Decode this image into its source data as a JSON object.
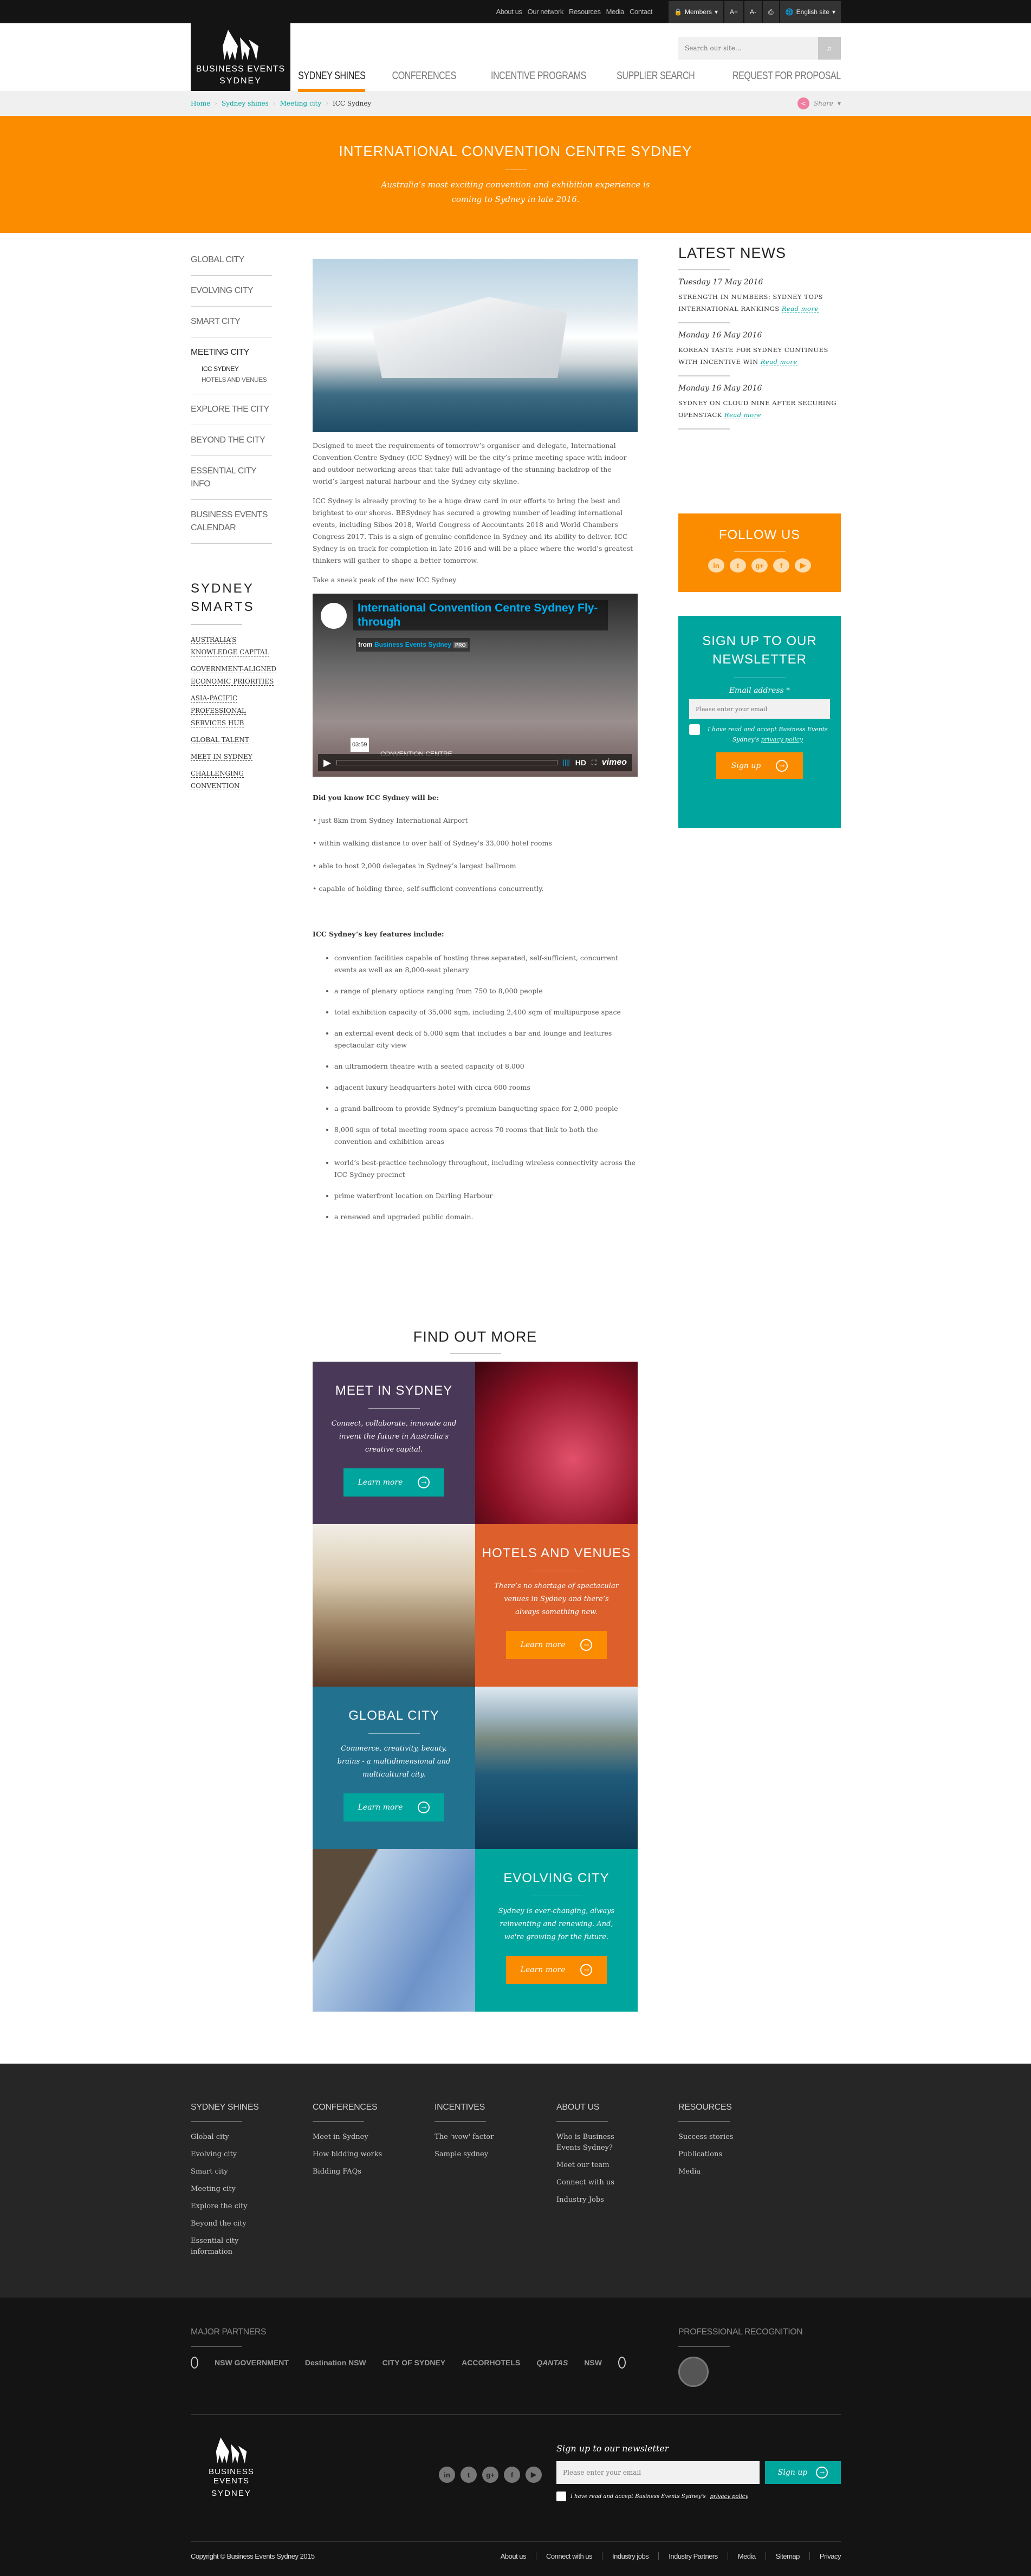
{
  "topbar": {
    "links": [
      "About us",
      "Our network",
      "Resources",
      "Media",
      "Contact"
    ],
    "members": "Members",
    "font_increase": "A+",
    "font_decrease": "A-",
    "print_icon": "printer-icon",
    "language": "English site"
  },
  "logo": {
    "line1": "BUSINESS EVENTS",
    "line2": "SYDNEY"
  },
  "search": {
    "placeholder": "Search our site..."
  },
  "nav": {
    "items": [
      "SYDNEY SHINES",
      "CONFERENCES",
      "INCENTIVE PROGRAMS",
      "SUPPLIER SEARCH",
      "REQUEST FOR PROPOSAL"
    ],
    "active": "SYDNEY SHINES"
  },
  "breadcrumb": {
    "items": [
      "Home",
      "Sydney shines",
      "Meeting city"
    ],
    "current": "ICC Sydney",
    "share": "Share"
  },
  "banner": {
    "title": "INTERNATIONAL CONVENTION CENTRE SYDNEY",
    "subtitle": "Australia’s most exciting convention and exhibition experience is coming to Sydney in late 2016."
  },
  "leftnav": {
    "items": [
      {
        "label": "GLOBAL CITY"
      },
      {
        "label": "EVOLVING CITY"
      },
      {
        "label": "SMART CITY"
      },
      {
        "label": "MEETING CITY",
        "sub": [
          "ICC SYDNEY",
          "HOTELS AND VENUES"
        ]
      },
      {
        "label": "EXPLORE THE CITY"
      },
      {
        "label": "BEYOND THE CITY"
      },
      {
        "label": "ESSENTIAL CITY INFO"
      },
      {
        "label": "BUSINESS EVENTS CALENDAR"
      }
    ]
  },
  "smarts": {
    "title": "SYDNEY SMARTS",
    "links": [
      "Australia’s knowledge capital",
      "Government-aligned economic priorities",
      "Asia-Pacific professional services hub",
      "Global talent",
      "Meet in Sydney",
      "Challenging convention"
    ]
  },
  "main": {
    "paragraphs": [
      "Designed to meet the requirements of tomorrow’s organiser and delegate, International Convention Centre Sydney (ICC Sydney) will be the city’s prime meeting space with indoor and outdoor networking areas that take full advantage of the stunning backdrop of the world’s largest natural harbour and the Sydney city skyline.",
      "ICC Sydney is already proving to be a huge draw card in our efforts to bring the best and brightest to our shores. BESydney has secured a growing number of leading international events, including Sibos 2018, World Congress of Accountants 2018 and World Chambers Congress 2017. This is a sign of genuine confidence in Sydney and its ability to deliver. ICC Sydney is on track for completion in late 2016 and will be a place where the world’s greatest thinkers will gather to shape a better tomorrow.",
      "Take a sneak peak of the new ICC Sydney"
    ],
    "video": {
      "title": "International Convention Centre Sydney Fly-through",
      "from": "from",
      "author": "Business Events Sydney",
      "badge": "PRO",
      "overlay": "CONVENTION CENTRE",
      "time": "03:59",
      "hd": "HD",
      "brand": "vimeo"
    },
    "did_you_know": "Did you know ICC Sydney will be:",
    "facts": [
      "• just 8km from Sydney International Airport",
      "• within walking distance to over half of Sydney's 33,000 hotel rooms",
      "• able to host 2,000 delegates in Sydney’s largest ballroom",
      "• capable of holding three, self-sufficient conventions concurrently."
    ],
    "features_heading": "ICC Sydney’s key features include:",
    "features": [
      "convention facilities capable of hosting three separated, self-sufficient, concurrent events as well as an 8,000-seat plenary",
      "a range of plenary options ranging from 750 to 8,000 people",
      "total exhibition capacity of 35,000 sqm, including 2,400 sqm of multipurpose space",
      "an external event deck of 5,000 sqm that includes a bar and lounge and features spectacular city view",
      "an ultramodern theatre with a seated capacity of 8,000",
      "adjacent luxury headquarters hotel with circa 600 rooms",
      "a grand ballroom to provide Sydney’s premium banqueting space for 2,000 people",
      "8,000 sqm of total meeting room space across 70 rooms that link to both the convention and exhibition areas",
      "world’s best-practice technology throughout, including wireless connectivity across the ICC Sydney precinct",
      "prime waterfront location on Darling Harbour",
      "a renewed and upgraded public domain."
    ]
  },
  "news": {
    "title": "LATEST NEWS",
    "items": [
      {
        "date": "Tuesday 17 May 2016",
        "headline": "Strength in numbers: Sydney tops international rankings",
        "read_more": "Read more"
      },
      {
        "date": "Monday 16 May 2016",
        "headline": "Korean taste for Sydney continues with incentive win",
        "read_more": "Read more"
      },
      {
        "date": "Monday 16 May 2016",
        "headline": "Sydney on cloud nine after securing OpenStack",
        "read_more": "Read more"
      }
    ]
  },
  "follow": {
    "title": "FOLLOW US",
    "socials": [
      {
        "icon": "linkedin-icon",
        "glyph": "in"
      },
      {
        "icon": "twitter-icon",
        "glyph": "t"
      },
      {
        "icon": "google-plus-icon",
        "glyph": "g+"
      },
      {
        "icon": "facebook-icon",
        "glyph": "f"
      },
      {
        "icon": "youtube-icon",
        "glyph": "▶"
      }
    ]
  },
  "newsletter": {
    "title": "SIGN UP TO OUR NEWSLETTER",
    "label": "Email address *",
    "placeholder": "Please enter your email",
    "consent": "I have read and accept Business Events Sydney's",
    "policy": "privacy policy",
    "button": "Sign up"
  },
  "find_out_more": {
    "title": "FIND OUT MORE",
    "tiles": [
      {
        "title": "MEET IN SYDNEY",
        "text": "Connect, collaborate, innovate and invent the future in Australia's creative capital.",
        "button": "Learn more",
        "color": "#4a3858",
        "button_color": "#00a59e"
      },
      {
        "title": "HOTELS AND VENUES",
        "text": "There’s no shortage of spectacular venues in Sydney and there’s always something new.",
        "button": "Learn more",
        "color": "#dc5f2c",
        "button_color": "#fb8c00"
      },
      {
        "title": "GLOBAL CITY",
        "text": "Commerce, creativity, beauty, brains - a multidimensional and multicultural city.",
        "button": "Learn more",
        "color": "#22718f",
        "button_color": "#00a59e"
      },
      {
        "title": "EVOLVING CITY",
        "text": "Sydney is ever-changing, always reinventing and renewing. And, we're growing for the future.",
        "button": "Learn more",
        "color": "#00a59e",
        "button_color": "#fb8c00"
      }
    ]
  },
  "footer": {
    "columns": [
      {
        "title": "SYDNEY SHINES",
        "links": [
          "Global city",
          "Evolving city",
          "Smart city",
          "Meeting city",
          "Explore the city",
          "Beyond the city",
          "Essential city information"
        ]
      },
      {
        "title": "CONFERENCES",
        "links": [
          "Meet in Sydney",
          "How bidding works",
          "Bidding FAQs"
        ]
      },
      {
        "title": "INCENTIVES",
        "links": [
          "The 'wow' factor",
          "Sample sydney"
        ]
      },
      {
        "title": "ABOUT US",
        "links": [
          "Who is Business Events Sydney?",
          "Meet our team",
          "Connect with us",
          "Industry Jobs"
        ]
      },
      {
        "title": "RESOURCES",
        "links": [
          "Success stories",
          "Publications",
          "Media"
        ]
      }
    ],
    "partners_title": "MAJOR PARTNERS",
    "partners": [
      "NSW GOVERNMENT",
      "Destination NSW",
      "CITY OF SYDNEY",
      "ACCORHOTELS",
      "QANTAS",
      "NSW"
    ],
    "recognition_title": "PROFESSIONAL RECOGNITION",
    "newsletter": {
      "title": "Sign up to our newsletter",
      "placeholder": "Please enter your email",
      "button": "Sign up",
      "consent": "I have read and accept Business Events Sydney's",
      "policy": "privacy policy"
    },
    "copyright": "Copyright © Business Events Sydney 2015",
    "links": [
      "About us",
      "Connect with us",
      "Industry jobs",
      "Industry Partners",
      "Media",
      "Sitemap",
      "Privacy"
    ]
  },
  "colors": {
    "orange": "#fb8c00",
    "teal": "#00a59e",
    "dark": "#141414"
  }
}
